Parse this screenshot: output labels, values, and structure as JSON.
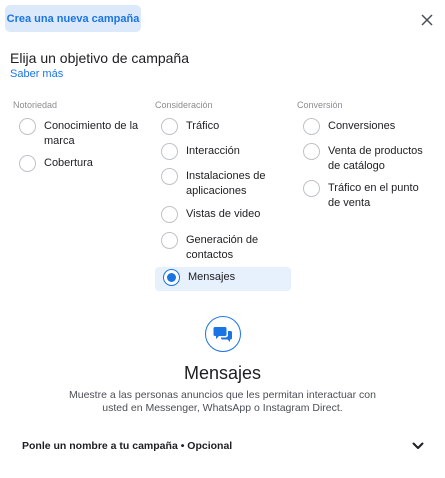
{
  "header": {
    "badge_label": "Crea una nueva campaña",
    "close_icon": "close-icon"
  },
  "objective_section": {
    "title": "Elija un objetivo de campaña",
    "learn_more": "Saber más"
  },
  "groups": [
    {
      "title": "Notoriedad",
      "options": [
        {
          "label": "Conocimiento de la marca",
          "selected": false
        },
        {
          "label": "Cobertura",
          "selected": false
        }
      ]
    },
    {
      "title": "Consideración",
      "options": [
        {
          "label": "Tráfico",
          "selected": false
        },
        {
          "label": "Interacción",
          "selected": false
        },
        {
          "label": "Instalaciones de aplicaciones",
          "selected": false
        },
        {
          "label": "Vistas de video",
          "selected": false
        },
        {
          "label": "Generación de contactos",
          "selected": false
        },
        {
          "label": "Mensajes",
          "selected": true
        }
      ]
    },
    {
      "title": "Conversión",
      "options": [
        {
          "label": "Conversiones",
          "selected": false
        },
        {
          "label": "Venta de productos de catálogo",
          "selected": false
        },
        {
          "label": "Tráfico en el punto de venta",
          "selected": false
        }
      ]
    }
  ],
  "selected_objective": {
    "icon": "messages-icon",
    "title": "Mensajes",
    "description": "Muestre a las personas anuncios que les permitan interactuar con usted en Messenger, WhatsApp o Instagram Direct."
  },
  "campaign_name": {
    "label": "Ponle un nombre a tu campaña • Opcional",
    "icon": "chevron-down-icon"
  },
  "colors": {
    "accent": "#1b74e4",
    "badge_bg": "#dce9fb",
    "selected_bg": "#e7f0fd"
  }
}
